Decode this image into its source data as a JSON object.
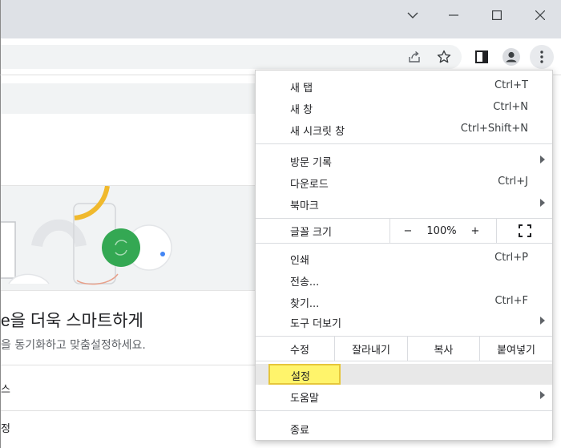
{
  "window": {
    "minimize_icon": "chevron-down-icon",
    "controls": [
      "minimize",
      "maximize",
      "close"
    ]
  },
  "toolbar": {
    "icons": [
      "share-icon",
      "star-icon",
      "side-panel-icon",
      "profile-icon",
      "more-vert-icon"
    ]
  },
  "page": {
    "heading": "e을 더욱 스마트하게",
    "subheading": "을 동기화하고 맞춤설정하세요.",
    "row1": "스",
    "row2": "정"
  },
  "menu": {
    "group1": [
      {
        "label": "새 탭",
        "shortcut": "Ctrl+T"
      },
      {
        "label": "새 창",
        "shortcut": "Ctrl+N"
      },
      {
        "label": "새 시크릿 창",
        "shortcut": "Ctrl+Shift+N"
      }
    ],
    "group2": [
      {
        "label": "방문 기록",
        "shortcut": ""
      },
      {
        "label": "다운로드",
        "shortcut": "Ctrl+J"
      },
      {
        "label": "북마크",
        "shortcut": ""
      }
    ],
    "zoom": {
      "label": "글꼴 크기",
      "minus": "−",
      "value": "100%",
      "plus": "+"
    },
    "group3": [
      {
        "label": "인쇄",
        "shortcut": "Ctrl+P"
      },
      {
        "label": "전송...",
        "shortcut": ""
      },
      {
        "label": "찾기...",
        "shortcut": "Ctrl+F"
      },
      {
        "label": "도구 더보기",
        "shortcut": ""
      }
    ],
    "edit": {
      "label": "수정",
      "cut": "잘라내기",
      "copy": "복사",
      "paste": "붙여넣기"
    },
    "settings": "설정",
    "help": "도움말",
    "exit": "종료"
  }
}
